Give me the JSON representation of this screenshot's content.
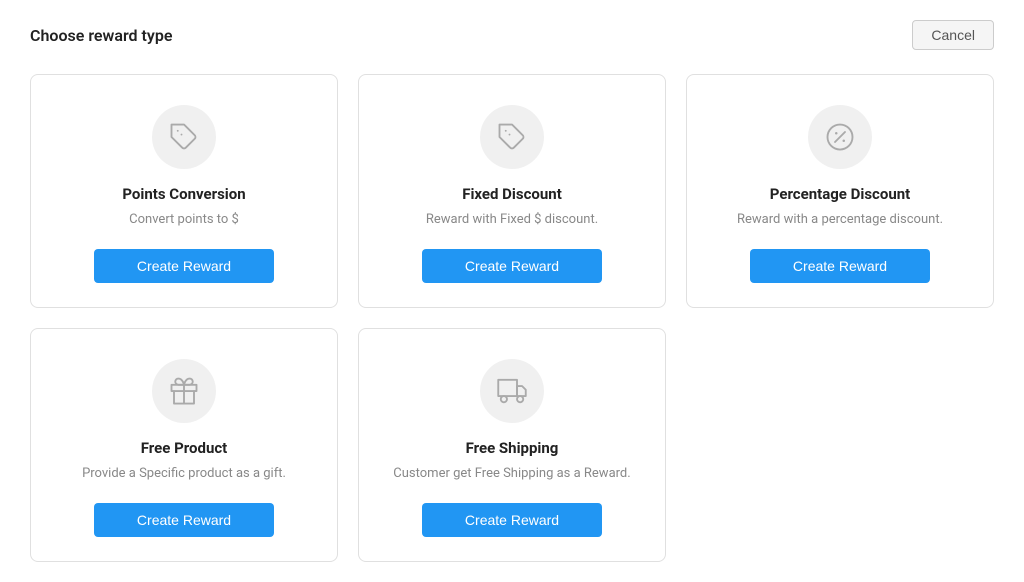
{
  "header": {
    "title": "Choose reward type",
    "cancel_label": "Cancel"
  },
  "cards": [
    {
      "id": "points-conversion",
      "title": "Points Conversion",
      "description": "Convert points to $",
      "button_label": "Create Reward",
      "icon": "tag"
    },
    {
      "id": "fixed-discount",
      "title": "Fixed Discount",
      "description": "Reward with Fixed $ discount.",
      "button_label": "Create Reward",
      "icon": "tag"
    },
    {
      "id": "percentage-discount",
      "title": "Percentage Discount",
      "description": "Reward with a percentage discount.",
      "button_label": "Create Reward",
      "icon": "percent"
    },
    {
      "id": "free-product",
      "title": "Free Product",
      "description": "Provide a Specific product as a gift.",
      "button_label": "Create Reward",
      "icon": "gift"
    },
    {
      "id": "free-shipping",
      "title": "Free Shipping",
      "description": "Customer get Free Shipping as a Reward.",
      "button_label": "Create Reward",
      "icon": "truck"
    }
  ]
}
